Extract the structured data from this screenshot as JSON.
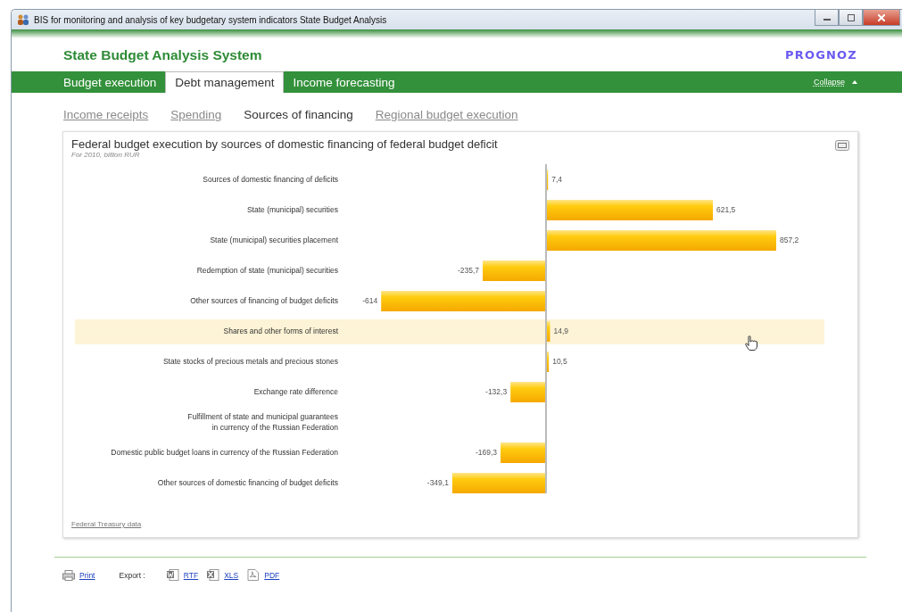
{
  "window": {
    "title": "BIS for monitoring and analysis of key budgetary system indicators State Budget Analysis"
  },
  "header": {
    "title": "State Budget Analysis System",
    "logo": "PROGNOZ"
  },
  "tabs": [
    {
      "label": "Budget execution",
      "selected": false
    },
    {
      "label": "Debt management",
      "selected": true
    },
    {
      "label": "Income forecasting",
      "selected": false
    }
  ],
  "collapse": {
    "label": "Collapse"
  },
  "subtabs": [
    {
      "label": "Income receipts",
      "selected": false
    },
    {
      "label": "Spending",
      "selected": false
    },
    {
      "label": "Sources of financing",
      "selected": true
    },
    {
      "label": "Regional budget execution",
      "selected": false
    }
  ],
  "panel": {
    "title": "Federal budget execution by sources of domestic financing of federal budget deficit",
    "subtitle": "For 2010, billion RUR",
    "source": "Federal Treasury data",
    "chart_data": {
      "type": "bar",
      "orientation": "horizontal",
      "categories": [
        "Sources of domestic financing of deficits",
        "State (municipal) securities",
        "State (municipal) securities placement",
        "Redemption of state (municipal) securities",
        "Other sources of financing of budget deficits",
        "Shares and other forms of interest",
        "State stocks of precious metals and precious stones",
        "Exchange rate difference",
        "Fulfillment of state and municipal guarantees\nin currency of the Russian Federation",
        "Domestic public budget loans in currency of the Russian Federation",
        "Other sources of domestic financing of budget deficits"
      ],
      "values": [
        7.4,
        621.5,
        857.2,
        -235.7,
        -614,
        14.9,
        10.5,
        -132.3,
        null,
        -169.3,
        -349.1
      ],
      "value_labels": [
        "7,4",
        "621,5",
        "857,2",
        "-235,7",
        "-614",
        "14,9",
        "10,5",
        "-132,3",
        null,
        "-169,3",
        "-349,1"
      ]
    },
    "rows": [
      {
        "selected": false
      },
      {
        "selected": false
      },
      {
        "selected": false
      },
      {
        "selected": false
      },
      {
        "selected": false
      },
      {
        "selected": true
      },
      {
        "selected": false
      },
      {
        "selected": false
      },
      {
        "selected": false
      },
      {
        "selected": false
      },
      {
        "selected": false
      }
    ]
  },
  "footer": {
    "print": "Print",
    "export_label": "Export :",
    "exports": [
      {
        "kind": "word",
        "label": "RTF"
      },
      {
        "kind": "excel",
        "label": "XLS"
      },
      {
        "kind": "pdf",
        "label": "PDF"
      }
    ]
  }
}
